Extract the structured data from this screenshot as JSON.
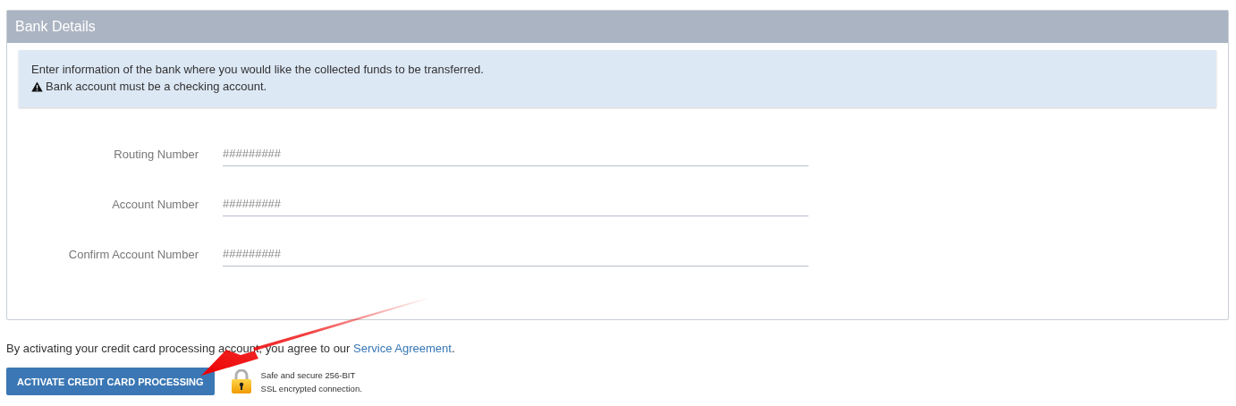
{
  "panel": {
    "title": "Bank Details"
  },
  "notice": {
    "message": "Enter information of the bank where you would like the collected funds to be transferred.",
    "warning": "Bank account must be a checking account."
  },
  "fields": [
    {
      "label": "Routing Number",
      "placeholder": "#########"
    },
    {
      "label": "Account Number",
      "placeholder": "#########"
    },
    {
      "label": "Confirm Account Number",
      "placeholder": "#########"
    }
  ],
  "agreement": {
    "text": "By activating your credit card processing account, you agree to our",
    "link": "Service Agreement",
    "end": "."
  },
  "button": {
    "label": "ACTIVATE CREDIT CARD PROCESSING"
  },
  "security": {
    "line_1": "Safe and secure 256-BIT",
    "line_2": "SSL encrypted connection."
  }
}
